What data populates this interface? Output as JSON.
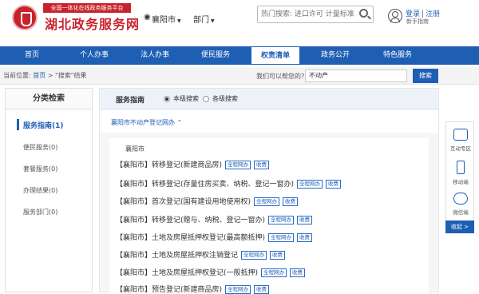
{
  "header": {
    "logo_subtitle": "全国一体化在线政务服务平台",
    "logo_title": "湖北政务服务网",
    "location": "襄阳市",
    "department": "部门",
    "search_placeholder": "热门搜索: 进口许可 计量标准",
    "login": "登录",
    "separator": "|",
    "register": "注册",
    "novice_guide": "新手指南"
  },
  "nav": {
    "items": [
      {
        "label": "首页"
      },
      {
        "label": "个人办事"
      },
      {
        "label": "法人办事"
      },
      {
        "label": "便民服务"
      },
      {
        "label": "权责清单"
      },
      {
        "label": "政务公开"
      },
      {
        "label": "特色服务"
      }
    ],
    "active_index": 4
  },
  "breadcrumb": {
    "prefix": "当前位置:",
    "home": "首页",
    "sep": ">",
    "current": "\"搜索\"结果"
  },
  "find": {
    "label": "我们可以帮您的?",
    "value": "不动产",
    "button": "搜索"
  },
  "sidebar": {
    "title": "分类检索",
    "items": [
      {
        "label": "服务指南(1)"
      },
      {
        "label": "便民服务(0)"
      },
      {
        "label": "套餐服务(0)"
      },
      {
        "label": "办理结果(0)"
      },
      {
        "label": "服务部门(0)"
      }
    ]
  },
  "main": {
    "guide_title": "服务指南",
    "radio_local": "本级搜索",
    "radio_all": "各级搜索",
    "subtitle": "襄阳市不动产登记网办",
    "city": "襄阳市",
    "tags": {
      "online": "全程网办",
      "fee": "收费"
    },
    "items": [
      {
        "prefix": "【襄阳市】",
        "name": "转移登记(新建商品房)"
      },
      {
        "prefix": "【襄阳市】",
        "name": "转移登记(存量住房买卖、纳税、登记一窗办)"
      },
      {
        "prefix": "【襄阳市】",
        "name": "首次登记(国有建设用地使用权)"
      },
      {
        "prefix": "【襄阳市】",
        "name": "转移登记(赠与、纳税、登记一窗办)"
      },
      {
        "prefix": "【襄阳市】",
        "name": "土地及房屋抵押权登记(最高额抵押)"
      },
      {
        "prefix": "【襄阳市】",
        "name": "土地及房屋抵押权注销登记"
      },
      {
        "prefix": "【襄阳市】",
        "name": "土地及房屋抵押权登记(一般抵押)"
      },
      {
        "prefix": "【襄阳市】",
        "name": "预告登记(新建商品房)"
      }
    ]
  },
  "float": {
    "interact": "互动专区",
    "mobile": "移动端",
    "wechat": "微信端",
    "collapse": "收起 >"
  }
}
